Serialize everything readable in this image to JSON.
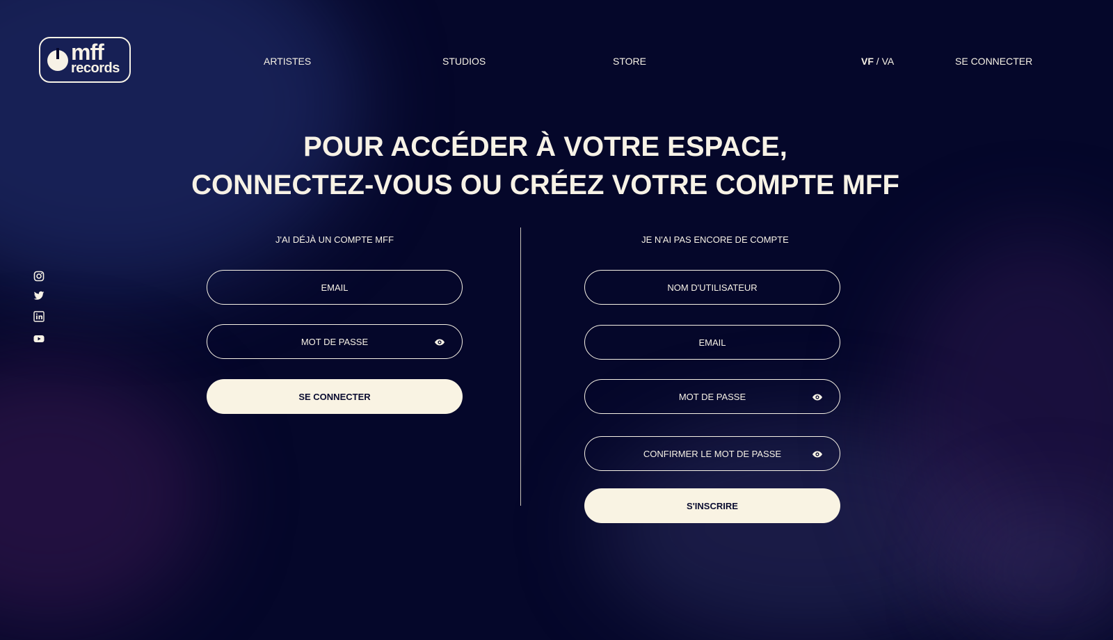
{
  "header": {
    "logo": {
      "line1": "mff",
      "line2": "records"
    },
    "nav": [
      {
        "label": "ARTISTES"
      },
      {
        "label": "STUDIOS"
      },
      {
        "label": "STORE"
      }
    ],
    "language": {
      "active": "VF",
      "separator": " / ",
      "other": "VA"
    },
    "login_link": "SE CONNECTER"
  },
  "social": [
    {
      "icon": "instagram-icon"
    },
    {
      "icon": "twitter-icon"
    },
    {
      "icon": "linkedin-icon"
    },
    {
      "icon": "youtube-icon"
    }
  ],
  "headline": {
    "line1": "POUR ACCÉDER À VOTRE ESPACE,",
    "line2": "CONNECTEZ-VOUS OU CRÉEZ VOTRE COMPTE MFF"
  },
  "login": {
    "title": "J'AI DÉJÀ UN COMPTE MFF",
    "email_placeholder": "EMAIL",
    "password_placeholder": "MOT DE PASSE",
    "submit_label": "SE CONNECTER"
  },
  "signup": {
    "title": "JE N'AI PAS ENCORE DE COMPTE",
    "username_placeholder": "NOM D'UTILISATEUR",
    "email_placeholder": "EMAIL",
    "password_placeholder": "MOT DE PASSE",
    "confirm_placeholder": "CONFIRMER LE MOT DE PASSE",
    "submit_label": "S'INSCRIRE"
  },
  "colors": {
    "background": "#05072a",
    "foreground": "#f7f2e6",
    "button_bg": "#f9f3e3",
    "button_text": "#0a0c30"
  }
}
